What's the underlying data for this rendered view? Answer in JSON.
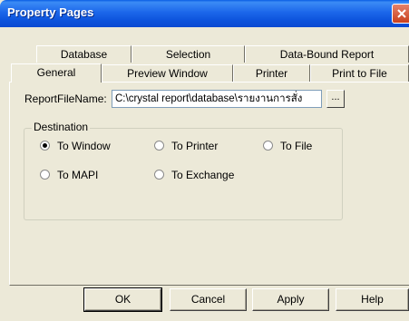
{
  "window": {
    "title": "Property Pages"
  },
  "tabs": {
    "back_row": [
      "Database",
      "Selection",
      "Data-Bound Report"
    ],
    "front_row": [
      "General",
      "Preview Window",
      "Printer",
      "Print to File"
    ],
    "active": "General"
  },
  "general": {
    "report_file_label": "ReportFileName:",
    "report_file_value": "C:\\crystal report\\database\\รายงานการสั่ง",
    "browse_label": "...",
    "destination_label": "Destination",
    "options": [
      {
        "label": "To Window",
        "checked": true
      },
      {
        "label": "To Printer",
        "checked": false
      },
      {
        "label": "To File",
        "checked": false
      },
      {
        "label": "To MAPI",
        "checked": false
      },
      {
        "label": "To Exchange",
        "checked": false
      }
    ]
  },
  "buttons": {
    "ok": "OK",
    "cancel": "Cancel",
    "apply": "Apply",
    "help": "Help"
  },
  "icons": {
    "close": "close-icon"
  },
  "colors": {
    "titlebar": "#0a5ee4",
    "close_button": "#d9522c",
    "dialog_background": "#ece9d8"
  }
}
